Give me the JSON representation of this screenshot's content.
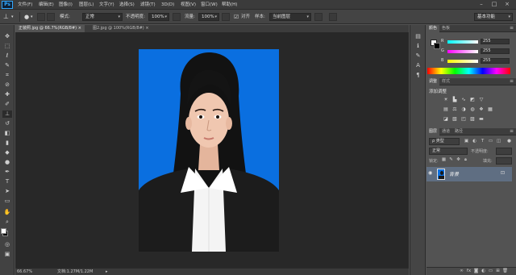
{
  "app": {
    "logo": "Ps"
  },
  "menu": [
    "文件(F)",
    "编辑(E)",
    "图像(I)",
    "图层(L)",
    "文字(Y)",
    "选择(S)",
    "滤镜(T)",
    "3D(D)",
    "视图(V)",
    "窗口(W)",
    "帮助(H)"
  ],
  "window_controls": [
    "minimize-icon",
    "maximize-icon",
    "close-icon"
  ],
  "options": {
    "mode_label": "模式:",
    "mode_value": "正常",
    "opacity_label": "不透明度:",
    "opacity_value": "100%",
    "flow_label": "流量:",
    "flow_value": "100%",
    "aligned_label": "对齐",
    "sample_label": "样本:",
    "sample_value": "当前图层",
    "workspace": "基本功能"
  },
  "documents": {
    "tabs": [
      "正装照.jpg @ 66.7%(RGB/8#)",
      "图2.jpg @ 100%(RGB/8#)"
    ],
    "zoom": "66.67%",
    "doc_info": "文档:1.27M/1.22M"
  },
  "color_panel": {
    "tabs": [
      "颜色",
      "色板"
    ],
    "channels": [
      {
        "name": "R",
        "value": "255"
      },
      {
        "name": "G",
        "value": "255"
      },
      {
        "name": "B",
        "value": "255"
      }
    ]
  },
  "adjust_panel": {
    "tabs": [
      "调整",
      "样式"
    ],
    "title": "添加调整"
  },
  "layers_panel": {
    "tabs": [
      "图层",
      "通道",
      "路径"
    ],
    "filter_value": "ρ 类型",
    "blend_value": "正常",
    "opacity_label": "不透明度:",
    "lock_label": "锁定:",
    "fill_label": "填充:",
    "layers": [
      {
        "name": "背景"
      }
    ]
  },
  "colors": {
    "accent": "#31a8ff",
    "photo_bg": "#0a6fe0"
  }
}
